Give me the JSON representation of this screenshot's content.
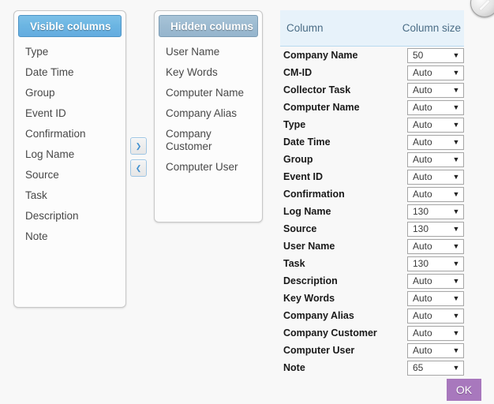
{
  "colors": {
    "background": "#f8f8f8",
    "active_header": "#6bb5e2",
    "inactive_header": "#9dbbd1",
    "table_header_bg": "#e7f2fa",
    "table_header_text": "#4a6c85",
    "accent_button": "#a878bd",
    "arrow_blue": "#3f8fcf"
  },
  "visible_panel": {
    "title": "Visible columns",
    "items": [
      "Type",
      "Date Time",
      "Group",
      "Event ID",
      "Confirmation",
      "Log Name",
      "Source",
      "Task",
      "Description",
      "Note"
    ]
  },
  "hidden_panel": {
    "title": "Hidden columns",
    "items": [
      "User Name",
      "Key Words",
      "Computer Name",
      "Company Alias",
      "Company Customer",
      "Computer User"
    ]
  },
  "transfer_buttons": {
    "move_right": "❯",
    "move_left": "❮"
  },
  "column_table": {
    "headers": {
      "column": "Column",
      "size": "Column size"
    },
    "size_options": [
      "Auto",
      "50",
      "65",
      "130"
    ],
    "rows": [
      {
        "label": "Company Name",
        "size": "50"
      },
      {
        "label": "CM-ID",
        "size": "Auto"
      },
      {
        "label": "Collector Task",
        "size": "Auto"
      },
      {
        "label": "Computer Name",
        "size": "Auto"
      },
      {
        "label": "Type",
        "size": "Auto"
      },
      {
        "label": "Date Time",
        "size": "Auto"
      },
      {
        "label": "Group",
        "size": "Auto"
      },
      {
        "label": "Event ID",
        "size": "Auto"
      },
      {
        "label": "Confirmation",
        "size": "Auto"
      },
      {
        "label": "Log Name",
        "size": "130"
      },
      {
        "label": "Source",
        "size": "130"
      },
      {
        "label": "User Name",
        "size": "Auto"
      },
      {
        "label": "Task",
        "size": "130"
      },
      {
        "label": "Description",
        "size": "Auto"
      },
      {
        "label": "Key Words",
        "size": "Auto"
      },
      {
        "label": "Company Alias",
        "size": "Auto"
      },
      {
        "label": "Company Customer",
        "size": "Auto"
      },
      {
        "label": "Computer User",
        "size": "Auto"
      },
      {
        "label": "Note",
        "size": "65"
      }
    ]
  },
  "footer": {
    "ok_label": "OK"
  },
  "icons": {
    "dropdown_arrow": "▼",
    "corner_badge": "circle-badge-icon"
  }
}
